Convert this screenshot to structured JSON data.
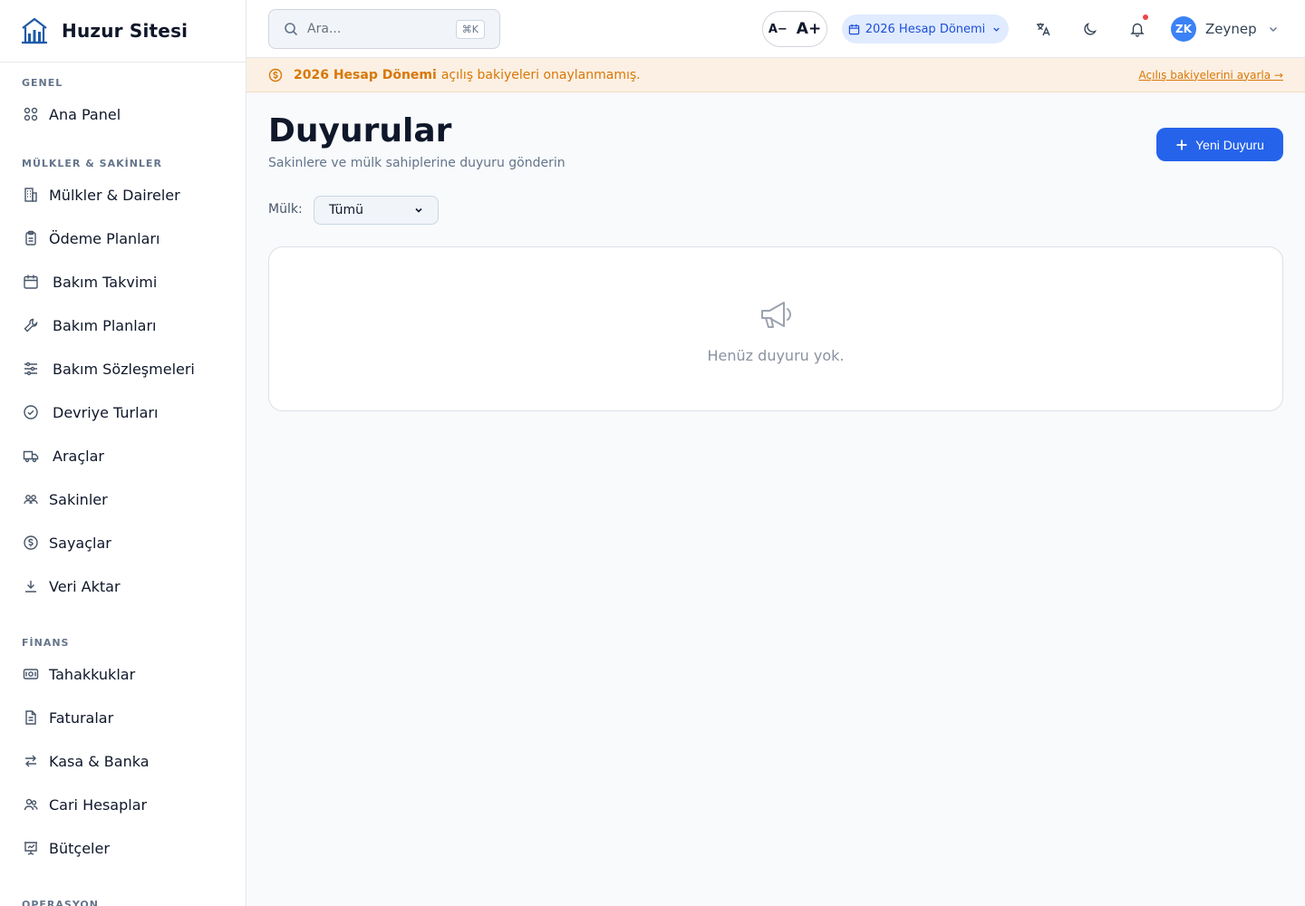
{
  "brand": {
    "name": "Huzur Sitesi"
  },
  "sidebar": {
    "sections": [
      {
        "title": "GENEL",
        "items": [
          {
            "label": "Ana Panel",
            "icon": "grid-icon"
          }
        ]
      },
      {
        "title": "MÜLKLER & SAKİNLER",
        "items": [
          {
            "label": "Mülkler & Daireler",
            "icon": "building-icon"
          },
          {
            "label": "Ödeme Planları",
            "icon": "clipboard-icon"
          },
          {
            "label": "Bakım Takvimi",
            "icon": "calendar-icon"
          },
          {
            "label": "Bakım Planları",
            "icon": "wrench-icon"
          },
          {
            "label": "Bakım Sözleşmeleri",
            "icon": "sliders-icon"
          },
          {
            "label": "Devriye Turları",
            "icon": "check-circle-icon"
          },
          {
            "label": "Araçlar",
            "icon": "truck-icon"
          },
          {
            "label": "Sakinler",
            "icon": "residents-icon"
          },
          {
            "label": "Sayaçlar",
            "icon": "dollar-circle-icon"
          },
          {
            "label": "Veri Aktar",
            "icon": "download-icon"
          }
        ]
      },
      {
        "title": "FİNANS",
        "items": [
          {
            "label": "Tahakkuklar",
            "icon": "banknote-icon"
          },
          {
            "label": "Faturalar",
            "icon": "file-icon"
          },
          {
            "label": "Kasa & Banka",
            "icon": "arrows-exchange-icon"
          },
          {
            "label": "Cari Hesaplar",
            "icon": "users-icon"
          },
          {
            "label": "Bütçeler",
            "icon": "presentation-icon"
          }
        ]
      },
      {
        "title": "OPERASYON",
        "items": []
      }
    ]
  },
  "topbar": {
    "search_placeholder": "Ara...",
    "search_shortcut": "⌘K",
    "font_decrease": "A−",
    "font_increase": "A+",
    "period_label": "2026 Hesap Dönemi",
    "user_initials": "ZK",
    "user_name": "Zeynep"
  },
  "banner": {
    "strong": "2026 Hesap Dönemi",
    "text": "açılış bakiyeleri onaylanmamış.",
    "link": "Açılış bakiyelerini ayarla →"
  },
  "main": {
    "title": "Duyurular",
    "subtitle": "Sakinlere ve mülk sahiplerine duyuru gönderin",
    "new_button": "Yeni Duyuru",
    "filter_label": "Mülk:",
    "filter_value": "Tümü",
    "empty_text": "Henüz duyuru yok."
  },
  "colors": {
    "primary": "#2563eb",
    "warning": "#d97706",
    "warning_bg": "#fbf0e3",
    "notification_dot": "#ef4444"
  }
}
